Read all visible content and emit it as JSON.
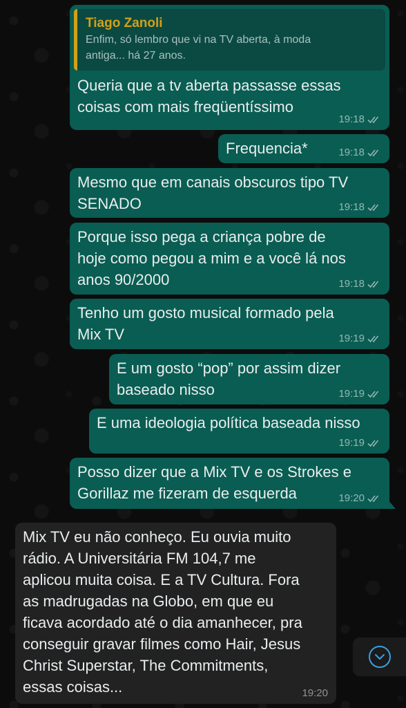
{
  "chat": {
    "messages": [
      {
        "direction": "out",
        "quote": {
          "author": "Tiago Zanoli",
          "text_line1": "Enfim, só lembro que vi na TV aberta, à moda",
          "text_line2": "antiga... há 27 anos."
        },
        "line1": "Queria que a tv aberta passasse essas",
        "line2": "coisas com mais freqüentíssimo",
        "time": "19:18"
      },
      {
        "direction": "out",
        "line1": "Frequencia*",
        "time": "19:18"
      },
      {
        "direction": "out",
        "line1": "Mesmo que em canais obscuros tipo TV",
        "line2": "SENADO",
        "time": "19:18"
      },
      {
        "direction": "out",
        "line1": "Porque isso pega a criança pobre de",
        "line2": "hoje como pegou a mim e a você lá nos",
        "line3": "anos 90/2000",
        "time": "19:18"
      },
      {
        "direction": "out",
        "line1": "Tenho um gosto musical formado pela",
        "line2": "Mix TV",
        "time": "19:19"
      },
      {
        "direction": "out",
        "line1": "E um gosto “pop” por assim dizer",
        "line2": "baseado nisso",
        "time": "19:19"
      },
      {
        "direction": "out",
        "line1": "E uma ideologia política baseada nisso",
        "time": "19:19"
      },
      {
        "direction": "out",
        "line1": "Posso dizer que a Mix TV e os Strokes e",
        "line2": "Gorillaz me fizeram de esquerda",
        "time": "19:20"
      },
      {
        "direction": "in",
        "lines": [
          "Mix TV eu não conheço. Eu ouvia muito",
          "rádio. A Universitária FM 104,7 me",
          "aplicou muita coisa. E a TV Cultura. Fora",
          "as madrugadas na Globo, em que eu",
          "ficava acordado até o dia amanhecer, pra",
          "conseguir gravar filmes como Hair, Jesus",
          "Christ Superstar, The Commitments,",
          "essas coisas..."
        ],
        "time": "19:20"
      }
    ]
  },
  "icons": {
    "read_ticks": "double-check-icon",
    "scroll_down": "chevron-down-icon"
  },
  "colors": {
    "outgoing_bubble": "#0a5d52",
    "incoming_bubble": "#222222",
    "quote_author": "#d4a017",
    "scroll_accent": "#3aa0e0"
  }
}
